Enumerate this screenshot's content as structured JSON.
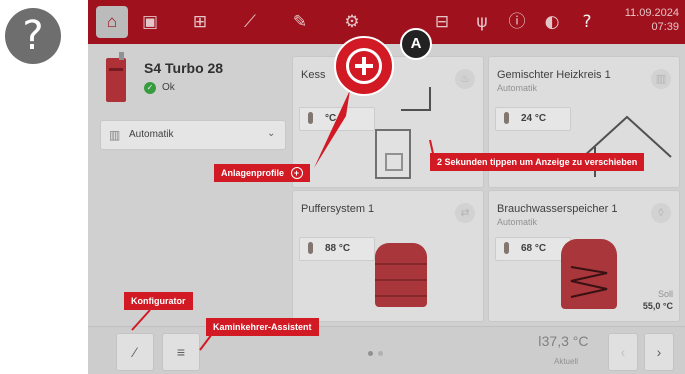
{
  "help_glyph": "?",
  "topbar": {
    "date": "11.09.2024",
    "time": "07:39",
    "icons": [
      "home-icon",
      "boiler-icon",
      "components-icon",
      "chart-icon",
      "wrench-icon",
      "gear-icon",
      "network-icon",
      "usb-icon",
      "info-icon",
      "profile-icon",
      "help-icon"
    ]
  },
  "device": {
    "name": "S4 Turbo 28",
    "status": "Ok"
  },
  "mode_select": {
    "value": "Automatik"
  },
  "tiles": {
    "kessel": {
      "title": "Kess",
      "temp": "°C"
    },
    "heizkreis": {
      "title": "Gemischter Heizkreis 1",
      "subtitle": "Automatik",
      "temp": "24 °C"
    },
    "puffer": {
      "title": "Puffersystem 1",
      "temp": "88 °C"
    },
    "brauchwasser": {
      "title": "Brauchwasserspeicher 1",
      "subtitle": "Automatik",
      "temp": "68 °C",
      "soll_label": "Soll",
      "soll_value": "55,0 °C"
    }
  },
  "callouts": {
    "anlagenprofile": "Anlagenprofile",
    "move_hint": "2 Sekunden tippen um Anzeige zu verschieben",
    "konfigurator": "Konfigurator",
    "kaminkehrer": "Kaminkehrer-Assistent",
    "marker": "A"
  },
  "bottombar": {
    "outside_temp": "37,3 °C",
    "outside_label": "Aktuell"
  },
  "colors": {
    "brand_red": "#a8121e",
    "callout_red": "#d21a25",
    "status_ok": "#3aa543"
  }
}
